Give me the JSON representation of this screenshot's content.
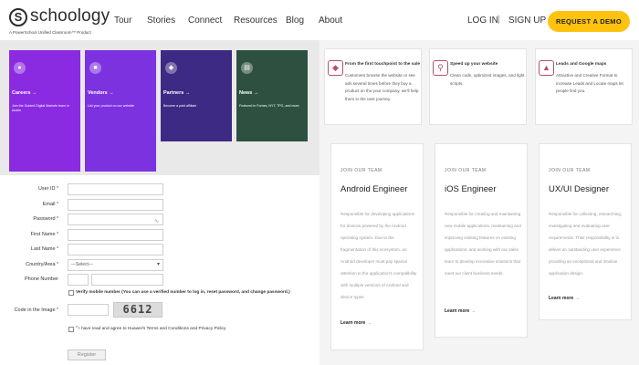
{
  "header": {
    "logo_mark": "S",
    "logo_text": "schoology",
    "logo_subtitle": "A PowerSchool Unified Classroom™ Product",
    "nav": [
      "Tour",
      "Stories",
      "Connect",
      "Resources",
      "Blog",
      "About"
    ],
    "login": "LOG IN",
    "separator": "|",
    "signup": "SIGN UP",
    "demo_button": "REQUEST A DEMO"
  },
  "cards": [
    {
      "title": "Careers →",
      "desc": "Join the Guided Digital Markets team in Austin",
      "color": "#8a2be2",
      "icon": "people-icon"
    },
    {
      "title": "Vendors →",
      "desc": "List your product on our website",
      "color": "#7d32e0",
      "icon": "vendor-icon"
    },
    {
      "title": "Partners →",
      "desc": "Become a paid affiliate",
      "color": "#3d2a85",
      "icon": "handshake-icon"
    },
    {
      "title": "News →",
      "desc": "Featured in Forbes, NYT, TPG, and more",
      "color": "#2d5041",
      "icon": "news-icon"
    }
  ],
  "form": {
    "fields": [
      {
        "label": "User ID",
        "required": "*",
        "value": ""
      },
      {
        "label": "Email",
        "required": "*",
        "value": ""
      },
      {
        "label": "Password",
        "required": "*",
        "value": ""
      },
      {
        "label": "First Name",
        "required": "*",
        "value": ""
      },
      {
        "label": "Last Name",
        "required": "*",
        "value": ""
      },
      {
        "label": "Country/Area",
        "required": "*",
        "value": "---Select---"
      },
      {
        "label": "Phone Number",
        "required": "",
        "value": ""
      }
    ],
    "verify_text": "Verify mobile number (You can use a verified number to log in, reset password, and change password.)",
    "code_label": "Code in the Image",
    "code_required": "*",
    "captcha": "6612",
    "agree_required": "*",
    "agree_text": "I have read and agree to Huawei's Terms and Conditions and Privacy Policy",
    "register_button": "Register"
  },
  "features": [
    {
      "title": "From the first touchpoint to the sale",
      "desc": "Customers browse the website or see ads several times before they buy a product on the your company, we'll help them in the user journey.",
      "icon": "touchpoint-icon"
    },
    {
      "title": "Speed up your website",
      "desc": "Clean code, optimized images, and light scripts.",
      "icon": "speed-icon"
    },
    {
      "title": "Leads and Google maps",
      "desc": "Attractive and Creative Format to increase Leads and Locate maps let people find you.",
      "icon": "map-icon"
    }
  ],
  "jobs": [
    {
      "tag": "JOIN OUR TEAM",
      "title": "Android Engineer",
      "desc": "Responsible for developing applications for devices powered by the Android operating system. Due to the fragmentation of this ecosystem, an Android developer must pay special attention to the application's compatibility with multiple versions of Android and device types.",
      "link": "Learn more",
      "arrow": "→"
    },
    {
      "tag": "JOIN OUR TEAM",
      "title": "iOS Engineer",
      "desc": "Responsible for creating and maintaining new mobile applications, maintaining and improving existing features on existing applications, and working with our sales team to develop innovative solutions that meet our client business needs.",
      "link": "Learn more",
      "arrow": "→"
    },
    {
      "tag": "JOIN OUR TEAM",
      "title": "UX/UI Designer",
      "desc": "Responsible for collecting, researching, investigating and evaluating user requirements. Their responsibility is to deliver an outstanding user experience providing an exceptional and intuitive application design.",
      "link": "Learn more",
      "arrow": "→"
    }
  ]
}
